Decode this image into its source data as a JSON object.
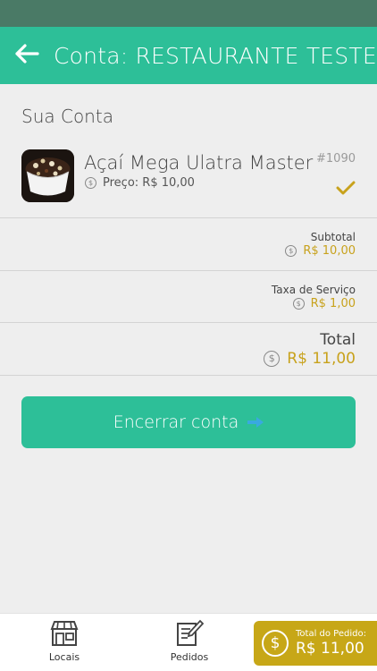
{
  "header": {
    "title": "Conta: RESTAURANTE TESTE"
  },
  "account": {
    "section_title": "Sua Conta",
    "item": {
      "name": "Açaí Mega Ulatra Master",
      "id": "#1090",
      "price_label": "Preço: R$ 10,00"
    },
    "subtotal": {
      "label": "Subtotal",
      "value": "R$ 10,00"
    },
    "service_fee": {
      "label": "Taxa de Serviço",
      "value": "R$ 1,00"
    },
    "total": {
      "label": "Total",
      "value": "R$ 11,00"
    },
    "close_button": "Encerrar conta"
  },
  "tabbar": {
    "locais": "Locais",
    "pedidos": "Pedidos",
    "order_total_label": "Total do Pedido:",
    "order_total_value": "R$ 11,00"
  },
  "colors": {
    "primary": "#2dbf98",
    "accent_gold": "#c8a21c",
    "status_bar": "#4a7a66",
    "background": "#eeeeee"
  },
  "icons": [
    "back-arrow-icon",
    "dollar-coin-icon",
    "checkmark-icon",
    "arrow-right-icon",
    "storefront-icon",
    "order-pencil-icon"
  ]
}
